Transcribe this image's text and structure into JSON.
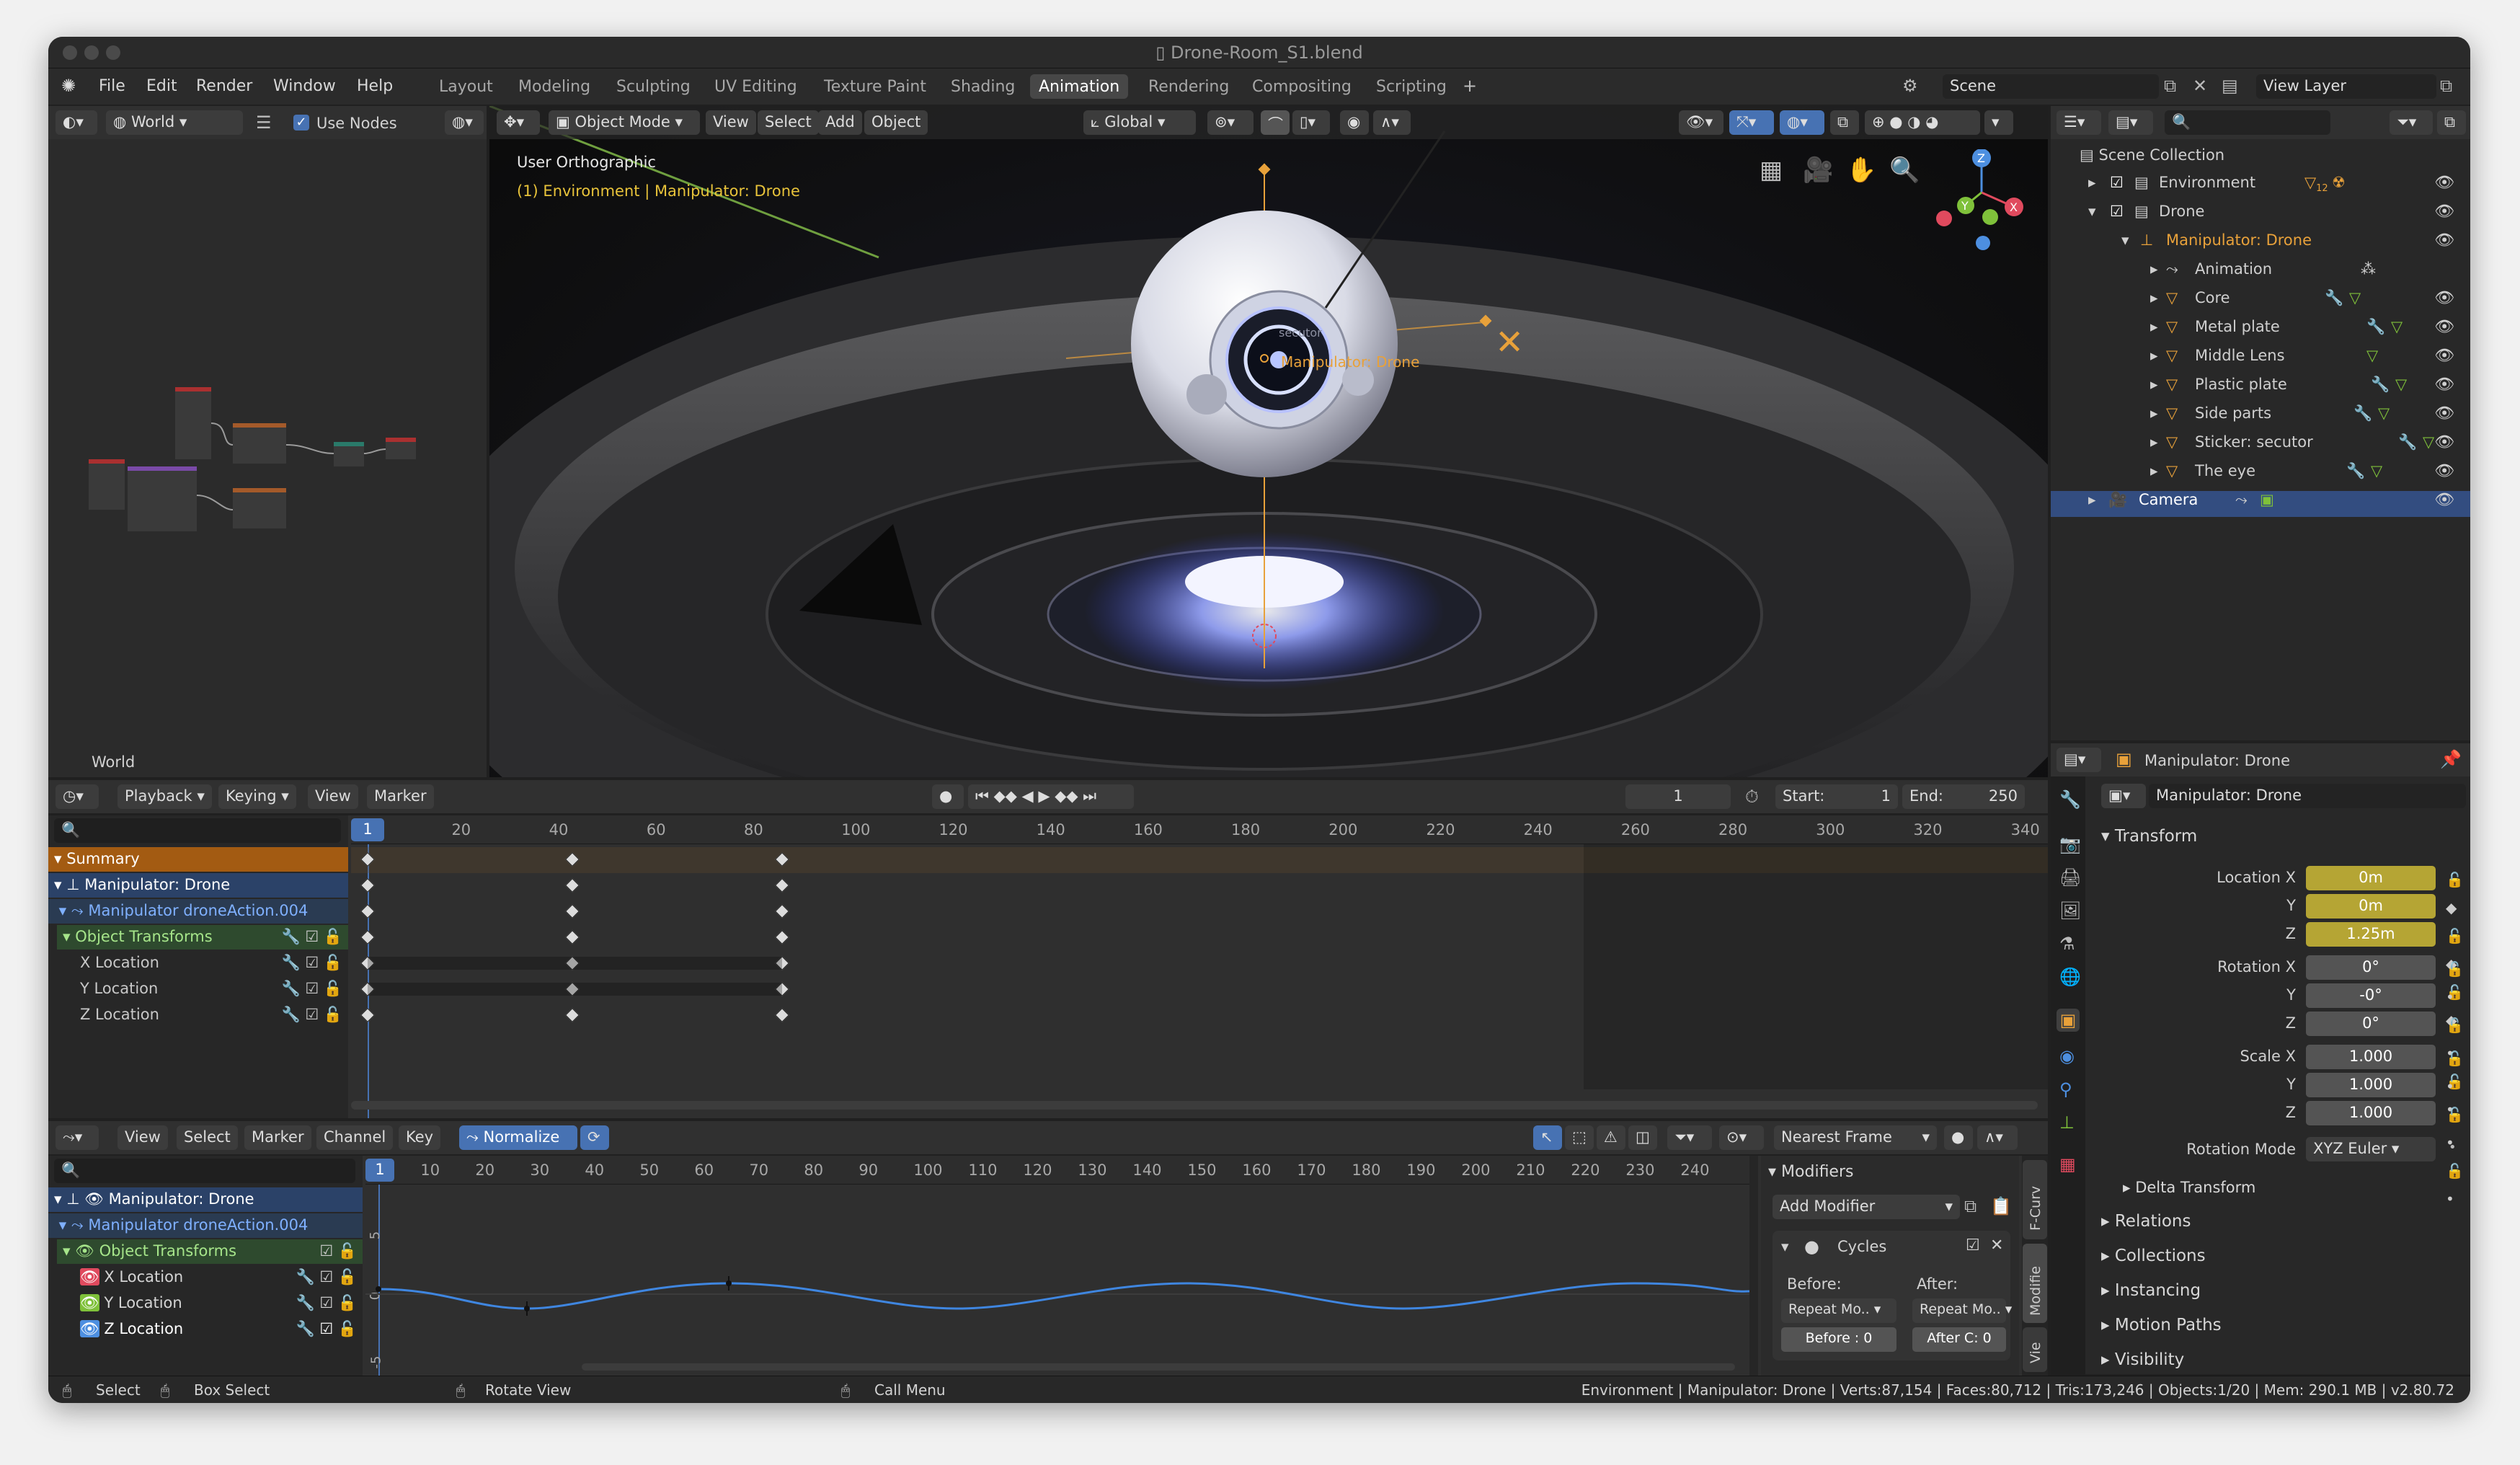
{
  "window": {
    "title": "Drone-Room_S1.blend"
  },
  "menu": [
    "File",
    "Edit",
    "Render",
    "Window",
    "Help"
  ],
  "workspaces": [
    {
      "label": "Layout"
    },
    {
      "label": "Modeling"
    },
    {
      "label": "Sculpting"
    },
    {
      "label": "UV Editing"
    },
    {
      "label": "Texture Paint"
    },
    {
      "label": "Shading"
    },
    {
      "label": "Animation",
      "active": true
    },
    {
      "label": "Rendering"
    },
    {
      "label": "Compositing"
    },
    {
      "label": "Scripting"
    }
  ],
  "scene": {
    "name": "Scene",
    "view_layer": "View Layer"
  },
  "node_editor": {
    "world_select": "World",
    "use_nodes": "Use Nodes",
    "footer": "World"
  },
  "viewport": {
    "mode": "Object Mode",
    "menus": [
      "View",
      "Select",
      "Add",
      "Object"
    ],
    "transform": "Global",
    "view_name": "User Orthographic",
    "context": "(1) Environment | Manipulator: Drone",
    "object_label": "Manipulator: Drone",
    "sticker": "secutor",
    "gizmo": {
      "x": "X",
      "y": "Y",
      "z": "Z"
    }
  },
  "outliner": {
    "root": "Scene Collection",
    "items": [
      {
        "label": "Environment",
        "badge": "12"
      },
      {
        "label": "Drone"
      },
      {
        "label": "Manipulator: Drone"
      },
      {
        "label": "Animation"
      },
      {
        "label": "Core"
      },
      {
        "label": "Metal plate"
      },
      {
        "label": "Middle Lens"
      },
      {
        "label": "Plastic plate"
      },
      {
        "label": "Side parts"
      },
      {
        "label": "Sticker: secutor"
      },
      {
        "label": "The eye"
      },
      {
        "label": "Camera"
      }
    ]
  },
  "properties": {
    "object_header": "Manipulator: Drone",
    "object_name": "Manipulator: Drone",
    "transform_title": "Transform",
    "location": {
      "label_x": "Location X",
      "x": "0m",
      "y": "0m",
      "z": "1.25m"
    },
    "rotation": {
      "label_x": "Rotation X",
      "x": "0°",
      "y": "-0°",
      "z": "0°"
    },
    "scale": {
      "label_x": "Scale X",
      "x": "1.000",
      "y": "1.000",
      "z": "1.000"
    },
    "axis_y": "Y",
    "axis_z": "Z",
    "rotation_mode_label": "Rotation Mode",
    "rotation_mode": "XYZ Euler",
    "sections": [
      "Delta Transform",
      "Relations",
      "Collections",
      "Instancing",
      "Motion Paths",
      "Visibility"
    ]
  },
  "timeline": {
    "menus": [
      "Playback",
      "Keying",
      "View",
      "Marker"
    ],
    "current_frame": "1",
    "start_label": "Start:",
    "start": "1",
    "end_label": "End:",
    "end": "250"
  },
  "dopesheet": {
    "ruler": [
      "20",
      "40",
      "60",
      "80",
      "100",
      "120",
      "140",
      "160",
      "180",
      "200",
      "220",
      "240",
      "260",
      "280",
      "300",
      "320",
      "340"
    ],
    "current": "1",
    "channels": [
      "Summary",
      "Manipulator: Drone",
      "Manipulator droneAction.004",
      "Object Transforms",
      "X Location",
      "Y Location",
      "Z Location"
    ],
    "key_frames": [
      1,
      43,
      86
    ]
  },
  "graph": {
    "menus": [
      "View",
      "Select",
      "Marker",
      "Channel",
      "Key"
    ],
    "normalize": "Normalize",
    "snap": "Nearest Frame",
    "ruler": [
      "10",
      "20",
      "30",
      "40",
      "50",
      "60",
      "70",
      "80",
      "90",
      "100",
      "110",
      "120",
      "130",
      "140",
      "150",
      "160",
      "170",
      "180",
      "190",
      "200",
      "210",
      "220",
      "230",
      "240"
    ],
    "current": "1",
    "channels": [
      "Manipulator: Drone",
      "Manipulator droneAction.004",
      "Object Transforms",
      "X Location",
      "Y Location",
      "Z Location"
    ],
    "y_ticks": [
      "5",
      "0",
      "-5"
    ],
    "modifiers": {
      "title": "Modifiers",
      "add": "Add Modifier",
      "cycles": "Cycles",
      "before_label": "Before:",
      "after_label": "After:",
      "before_mode": "Repeat Mo..",
      "after_mode": "Repeat Mo..",
      "before_count": "Before : 0",
      "after_count": "After C:  0"
    },
    "tabs": [
      "F-Curv",
      "Modifie",
      "Vie"
    ]
  },
  "status": {
    "select": "Select",
    "box_select": "Box Select",
    "rotate": "Rotate View",
    "call_menu": "Call Menu",
    "stats": "Environment | Manipulator: Drone | Verts:87,154 | Faces:80,712 | Tris:173,246 | Objects:1/20 | Mem: 290.1 MB | v2.80.72"
  },
  "colors": {
    "accent": "#4772b3",
    "keyframe_yellow": "#b5a534",
    "orange": "#e8a13a",
    "x_red": "#e04a5e",
    "y_green": "#7fc13a",
    "z_blue": "#4d8fe0"
  }
}
